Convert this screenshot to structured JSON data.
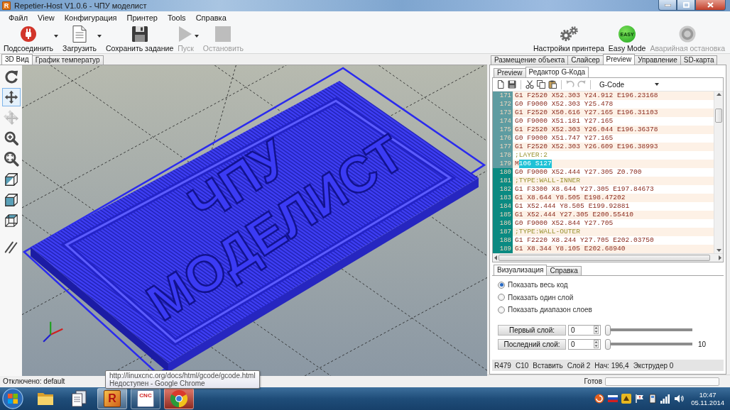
{
  "window": {
    "title": "Repetier-Host V1.0.6 - ЧПУ моделист",
    "icon_letter": "R"
  },
  "menu": [
    "Файл",
    "View",
    "Конфигурация",
    "Принтер",
    "Tools",
    "Справка"
  ],
  "toolbar": {
    "left": [
      {
        "kind": "connect",
        "label": "Подсоединить",
        "dropdown": true,
        "disabled": false
      },
      {
        "kind": "load",
        "label": "Загрузить",
        "dropdown": true,
        "disabled": false
      },
      {
        "kind": "save",
        "label": "Сохранить задание",
        "dropdown": false,
        "disabled": false
      },
      {
        "kind": "run",
        "label": "Пуск",
        "dropdown": true,
        "disabled": true
      },
      {
        "kind": "stop",
        "label": "Остановить",
        "dropdown": false,
        "disabled": true
      }
    ],
    "right": [
      {
        "kind": "settings",
        "label": "Настройки принтера",
        "disabled": false
      },
      {
        "kind": "easy",
        "label": "Easy Mode",
        "badge": "EASY",
        "disabled": false
      },
      {
        "kind": "emergency",
        "label": "Аварийная остановка",
        "disabled": true
      }
    ]
  },
  "main_tabs": [
    {
      "label": "3D Вид",
      "selected": true
    },
    {
      "label": "График температур",
      "selected": false
    }
  ],
  "view_tools": [
    {
      "kind": "rotate",
      "selected": false,
      "disabled": false
    },
    {
      "kind": "move",
      "selected": true,
      "disabled": false
    },
    {
      "kind": "move_object",
      "selected": false,
      "disabled": true
    },
    {
      "kind": "zoom",
      "selected": false,
      "disabled": false
    },
    {
      "kind": "fit",
      "selected": false,
      "disabled": false
    },
    {
      "kind": "view_iso",
      "selected": false,
      "disabled": false
    },
    {
      "kind": "view_front",
      "selected": false,
      "disabled": false
    },
    {
      "kind": "view_top",
      "selected": false,
      "disabled": false
    },
    {
      "kind": "parallel",
      "selected": false,
      "disabled": false
    }
  ],
  "viewport": {
    "model_text": [
      "ЧПУ",
      "МОДЕЛИСТ"
    ]
  },
  "panel_tabs": [
    {
      "label": "Размещение объекта",
      "selected": false
    },
    {
      "label": "Слайсер",
      "selected": false
    },
    {
      "label": "Preview",
      "selected": true
    },
    {
      "label": "Управление",
      "selected": false
    },
    {
      "label": "SD-карта",
      "selected": false
    }
  ],
  "sub_tabs": [
    {
      "label": "Preview",
      "selected": false
    },
    {
      "label": "Редактор G-Кода",
      "selected": true
    }
  ],
  "editor": {
    "tool_groups": [
      [
        {
          "kind": "new",
          "disabled": false
        },
        {
          "kind": "save",
          "disabled": false
        }
      ],
      [
        {
          "kind": "cut",
          "disabled": false
        },
        {
          "kind": "copy",
          "disabled": false
        },
        {
          "kind": "paste",
          "disabled": false
        }
      ],
      [
        {
          "kind": "undo",
          "disabled": true
        },
        {
          "kind": "redo",
          "disabled": true
        }
      ]
    ],
    "mode": "G-Code",
    "lines": [
      {
        "number": "171",
        "kind": "code",
        "text": "G1 F2520 X52.303 Y24.912 E196.23168",
        "marked": false
      },
      {
        "number": "172",
        "kind": "code",
        "text": "G0 F9000 X52.303 Y25.478",
        "marked": false
      },
      {
        "number": "173",
        "kind": "code",
        "text": "G1 F2520 X50.616 Y27.165 E196.31103",
        "marked": false
      },
      {
        "number": "174",
        "kind": "code",
        "text": "G0 F9000 X51.181 Y27.165",
        "marked": false
      },
      {
        "number": "175",
        "kind": "code",
        "text": "G1 F2520 X52.303 Y26.044 E196.36378",
        "marked": false
      },
      {
        "number": "176",
        "kind": "code",
        "text": "G0 F9000 X51.747 Y27.165",
        "marked": false
      },
      {
        "number": "177",
        "kind": "code",
        "text": "G1 F2520 X52.303 Y26.609 E196.38993",
        "marked": false
      },
      {
        "number": "178",
        "kind": "comment",
        "text": ";LAYER:2",
        "marked": false
      },
      {
        "number": "179",
        "kind": "code",
        "text": "M",
        "selected_text": "106 S127",
        "marked": false
      },
      {
        "number": "180",
        "kind": "code",
        "text": "G0 F9000 X52.444 Y27.305 Z0.700",
        "marked": true
      },
      {
        "number": "181",
        "kind": "comment",
        "text": ";TYPE:WALL-INNER",
        "marked": true
      },
      {
        "number": "182",
        "kind": "code",
        "text": "G1 F3300 X8.644 Y27.305 E197.84673",
        "marked": true
      },
      {
        "number": "183",
        "kind": "code",
        "text": "G1 X8.644 Y8.505 E198.47202",
        "marked": true
      },
      {
        "number": "184",
        "kind": "code",
        "text": "G1 X52.444 Y8.505 E199.92881",
        "marked": true
      },
      {
        "number": "185",
        "kind": "code",
        "text": "G1 X52.444 Y27.305 E200.55410",
        "marked": true
      },
      {
        "number": "186",
        "kind": "code",
        "text": "G0 F9000 X52.844 Y27.705",
        "marked": true
      },
      {
        "number": "187",
        "kind": "comment",
        "text": ";TYPE:WALL-OUTER",
        "marked": true
      },
      {
        "number": "188",
        "kind": "code",
        "text": "G1 F2220 X8.244 Y27.705 E202.03750",
        "marked": true
      },
      {
        "number": "189",
        "kind": "code",
        "text": "G1 X8.344 Y8.105 E202.68940",
        "marked": true
      }
    ]
  },
  "visual_tabs": [
    {
      "label": "Визуализация",
      "selected": true
    },
    {
      "label": "Справка",
      "selected": false
    }
  ],
  "radios": [
    {
      "label": "Показать весь код",
      "selected": true
    },
    {
      "label": "Показать один слой",
      "selected": false
    },
    {
      "label": "Показать диапазон слоев",
      "selected": false
    }
  ],
  "layers": [
    {
      "label": "Первый слой:",
      "value": "0",
      "level": 0
    },
    {
      "label": "Последний слой:",
      "value": "0",
      "level": 0,
      "reading": "10"
    }
  ],
  "editor_status": [
    "R479",
    "C10",
    "Вставить",
    "Слой 2",
    "Нач: 196,4",
    "Экструдер 0"
  ],
  "status_bar": {
    "text": "Отключено: default",
    "progress_label": "Готов",
    "level": 0
  },
  "tooltip": {
    "lines": [
      "http://linuxcnc.org/docs/html/gcode/gcode.html",
      "Недоступен - Google Chrome"
    ]
  },
  "taskbar": {
    "apps": [
      {
        "kind": "explorer",
        "running": false,
        "active": false,
        "highlighted": false
      },
      {
        "kind": "documents",
        "running": false,
        "active": false,
        "highlighted": false
      },
      {
        "kind": "repetier",
        "label": "R",
        "running": true,
        "active": true,
        "highlighted": false
      },
      {
        "kind": "cnc",
        "label": "CNC",
        "running": true,
        "active": false,
        "highlighted": false
      },
      {
        "kind": "chrome",
        "running": true,
        "active": false,
        "highlighted": true
      }
    ],
    "time": "10:47",
    "date": "05.11.2014"
  }
}
